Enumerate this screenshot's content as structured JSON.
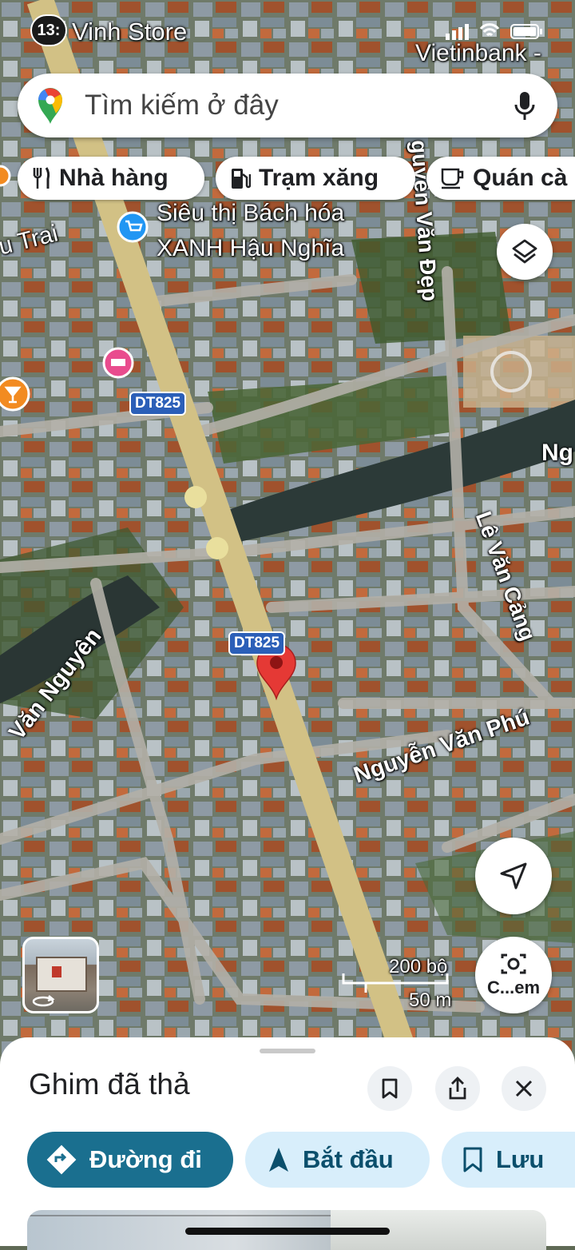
{
  "status_bar": {
    "time": "13:"
  },
  "map": {
    "poi_labels": {
      "vinh_store": "Vinh Store",
      "vietinbank": "Vietinbank -",
      "sieu_thi_line1": "Siêu thị Bách hóa",
      "sieu_thi_line2": "XANH Hậu Nghĩa",
      "u_trai": "u Trai"
    },
    "street_labels": {
      "nguyen_van_dep": "guyễn Văn Đẹp",
      "le_van_cang": "Lê Văn Cảng",
      "nguyen_van_phu": "Nguyễn Văn Phú",
      "van_nguyen": "Văn Nguyên",
      "ng": "Ng"
    },
    "road_shields": [
      "DT825",
      "DT825"
    ],
    "scale": {
      "feet": "200 bộ",
      "meters": "50 m"
    },
    "camera_button_label": "C...em",
    "pin_color": "#e53935"
  },
  "search": {
    "placeholder": "Tìm kiếm ở đây"
  },
  "chips": [
    {
      "label": "Nhà hàng",
      "icon": "restaurant-icon"
    },
    {
      "label": "Trạm xăng",
      "icon": "gas-station-icon"
    },
    {
      "label": "Quán cà",
      "icon": "coffee-icon"
    }
  ],
  "sheet": {
    "title": "Ghim đã thả",
    "actions": {
      "directions": "Đường đi",
      "start": "Bắt đầu",
      "save": "Lưu"
    }
  },
  "colors": {
    "accent": "#1a73a8",
    "accent_light": "#d8eefb",
    "pin": "#e53935"
  }
}
